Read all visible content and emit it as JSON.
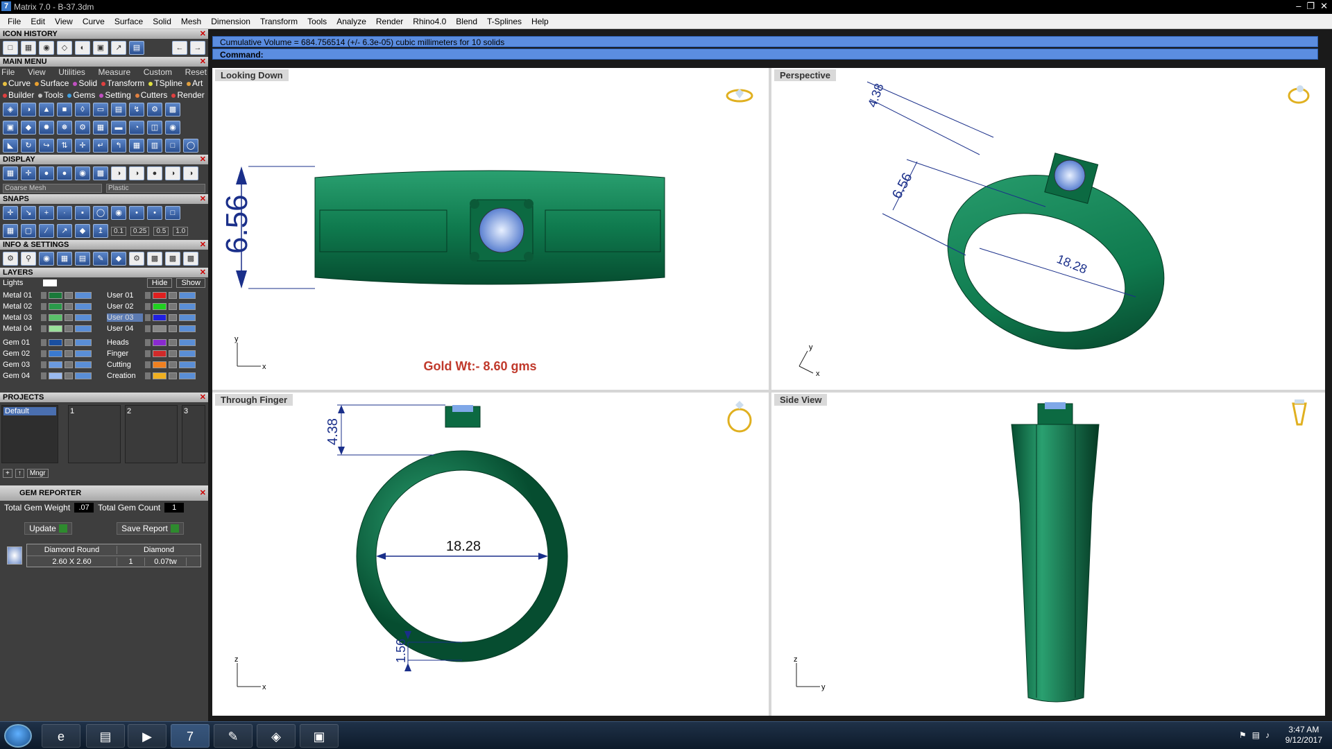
{
  "window": {
    "title": "Matrix 7.0 - B-37.3dm",
    "logo": "7"
  },
  "menubar": [
    "File",
    "Edit",
    "View",
    "Curve",
    "Surface",
    "Solid",
    "Mesh",
    "Dimension",
    "Transform",
    "Tools",
    "Analyze",
    "Render",
    "Rhino4.0",
    "Blend",
    "T-Splines",
    "Help"
  ],
  "panels": {
    "icon_history": "ICON HISTORY",
    "main_menu": "MAIN MENU",
    "main_sub": [
      "File",
      "View",
      "Utilities",
      "Measure",
      "Custom",
      "Reset"
    ],
    "cat_row1": [
      "Curve",
      "Surface",
      "Solid",
      "Transform",
      "TSpline",
      "Art"
    ],
    "cat_row2": [
      "Builder",
      "Tools",
      "Gems",
      "Setting",
      "Cutters",
      "Render"
    ],
    "display": "DISPLAY",
    "display_dd1": "Coarse Mesh",
    "display_dd2": "Plastic",
    "snaps": "SNAPS",
    "snap_values": [
      "0.1",
      "0.25",
      "0.5",
      "1.0"
    ],
    "info": "INFO & SETTINGS",
    "layers": "LAYERS",
    "lights": "Lights",
    "hide": "Hide",
    "show": "Show",
    "layers_left": [
      "Metal 01",
      "Metal 02",
      "Metal 03",
      "Metal 04",
      "Gem 01",
      "Gem 02",
      "Gem 03",
      "Gem 04"
    ],
    "layers_right": [
      "User 01",
      "User 02",
      "User 03",
      "User 04",
      "Heads",
      "Finger",
      "Cutting",
      "Creation"
    ],
    "projects": "PROJECTS",
    "project_default": "Default",
    "project_slots": [
      "1",
      "2",
      "3"
    ],
    "mngr": "Mngr",
    "gem_reporter": "GEM REPORTER",
    "total_gem_weight_label": "Total Gem Weight",
    "total_gem_weight": ".07",
    "total_gem_count_label": "Total Gem Count",
    "total_gem_count": "1",
    "update": "Update",
    "save_report": "Save Report",
    "gem_table": {
      "col1": "Diamond Round",
      "col2": "Diamond",
      "size": "2.60 X 2.60",
      "qty": "1",
      "tw": "0.07tw"
    }
  },
  "command": {
    "status": "Cumulative Volume = 684.756514 (+/- 6.3e-05) cubic millimeters for 10 solids",
    "prompt": "Command:"
  },
  "viewports": {
    "top_left": {
      "title": "Looking Down",
      "dim_height": "6.56",
      "gold_wt": "Gold Wt:- 8.60 gms"
    },
    "top_right": {
      "title": "Perspective",
      "dim1": "4.38",
      "dim2": "6.56",
      "dim3": "18.28"
    },
    "bottom_left": {
      "title": "Through Finger",
      "dim_top": "4.38",
      "dim_inner": "18.28",
      "dim_bottom": "1.56"
    },
    "bottom_right": {
      "title": "Side View"
    }
  },
  "axes": {
    "x": "x",
    "y": "y",
    "z": "z"
  },
  "colors": {
    "ring": "#0f7a4e",
    "ring_dark": "#064d30",
    "gem": "#7fa8e8",
    "dimension": "#1a2f8a",
    "gold_text": "#c0392b",
    "cmd_bar": "#5b8de0"
  },
  "taskbar": {
    "time": "3:47 AM",
    "date": "9/12/2017"
  }
}
